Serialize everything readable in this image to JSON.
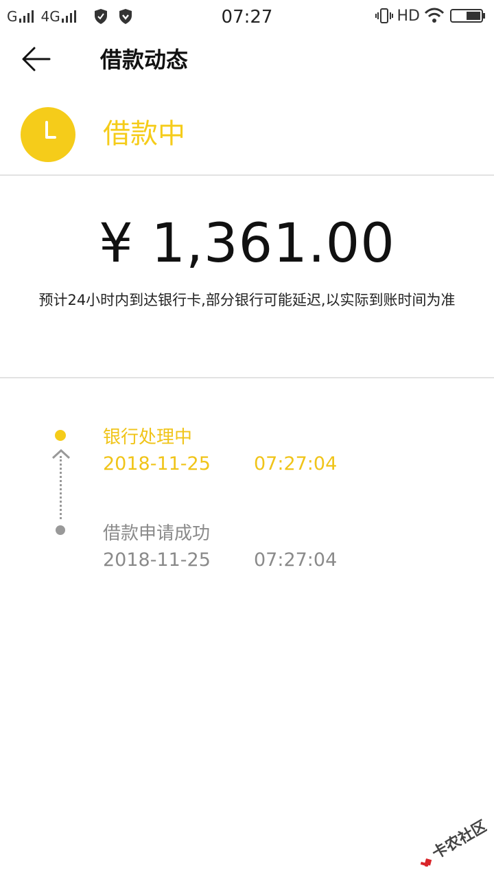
{
  "status_bar": {
    "carrier1": "G",
    "carrier2": "4G",
    "time": "07:27",
    "hd": "HD"
  },
  "header": {
    "title": "借款动态"
  },
  "status": {
    "label": "借款中",
    "color": "#f5cc1a"
  },
  "amount": {
    "value": "¥ 1,361.00"
  },
  "note": {
    "text": "预计24小时内到达银行卡,部分银行可能延迟,以实际到账时间为准"
  },
  "timeline": [
    {
      "title": "银行处理中",
      "date": "2018-11-25",
      "time": "07:27:04",
      "state": "active"
    },
    {
      "title": "借款申请成功",
      "date": "2018-11-25",
      "time": "07:27:04",
      "state": "done"
    }
  ],
  "watermark": {
    "text": "卡农社区"
  }
}
